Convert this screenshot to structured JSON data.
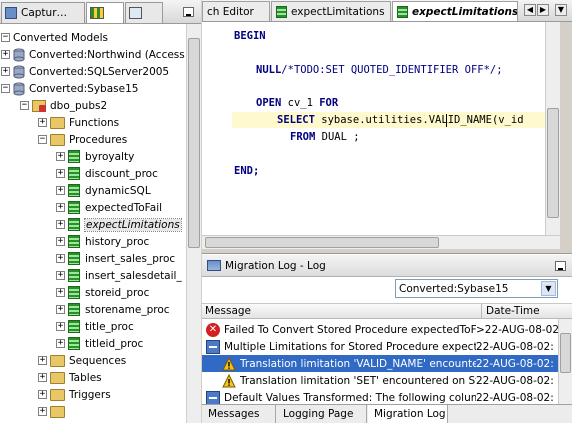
{
  "left_tabs": {
    "captured_label": "Captur…",
    "converted_label": "",
    "third_label": ""
  },
  "tree": {
    "root": "Converted Models",
    "models": [
      {
        "label": "Converted:Northwind (Access"
      },
      {
        "label": "Converted:SQLServer2005"
      },
      {
        "label": "Converted:Sybase15"
      }
    ],
    "schema": "dbo_pubs2",
    "folders": {
      "functions": "Functions",
      "procedures": "Procedures",
      "sequences": "Sequences",
      "tables": "Tables",
      "triggers": "Triggers"
    },
    "procedures": [
      "byroyalty",
      "discount_proc",
      "dynamicSQL",
      "expectedToFail",
      "expectLimitations",
      "history_proc",
      "insert_sales_proc",
      "insert_salesdetail_",
      "storeid_proc",
      "storename_proc",
      "title_proc",
      "titleid_proc"
    ],
    "selected_procedure": "expectLimitations"
  },
  "editor": {
    "tabs": [
      {
        "label": "ch Editor"
      },
      {
        "label": "expectLimitations"
      },
      {
        "label": "expectLimitations"
      }
    ],
    "code": {
      "begin": "BEGIN",
      "null_kw": "NULL",
      "null_comment": "/*TODO:SET QUOTED_IDENTIFIER OFF*/;",
      "open_kw": "OPEN",
      "open_cursor": " cv_1 ",
      "for_kw": "FOR",
      "select_kw": "SELECT",
      "select_expr": " sybase.utilities.VALID_NAME(v_id",
      "from_kw": "FROM",
      "from_rest": " DUAL ;",
      "end": "END;"
    }
  },
  "log": {
    "title": "Migration Log - Log",
    "filter_value": "Converted:Sybase15",
    "col_message": "Message",
    "col_date": "Date-Time",
    "rows": [
      {
        "icon": "error-icon",
        "message": "Failed To Convert Stored Procedure expectedToFail",
        "date": ">22-AUG-08-02:"
      },
      {
        "icon": "group-icon",
        "message": "Multiple Limitations for Stored Procedure expectLimitat",
        "date": "22-AUG-08-02:"
      },
      {
        "icon": "warning-icon",
        "message": "Translation limitation 'VALID_NAME' encountered o",
        "date": "22-AUG-08-02:"
      },
      {
        "icon": "warning-icon",
        "message": "Translation limitation 'SET' encountered on Stored",
        "date": "22-AUG-08-02:"
      },
      {
        "icon": "group-icon",
        "message": "Default Values Transformed: The following column def",
        "date": "22-AUG-08-02:"
      }
    ],
    "bottom_tabs": [
      "Messages",
      "Logging Page",
      "Migration Log"
    ]
  },
  "colors": {
    "selection": "#316ac5",
    "keyword": "#000080",
    "current_line": "#fffacd"
  }
}
